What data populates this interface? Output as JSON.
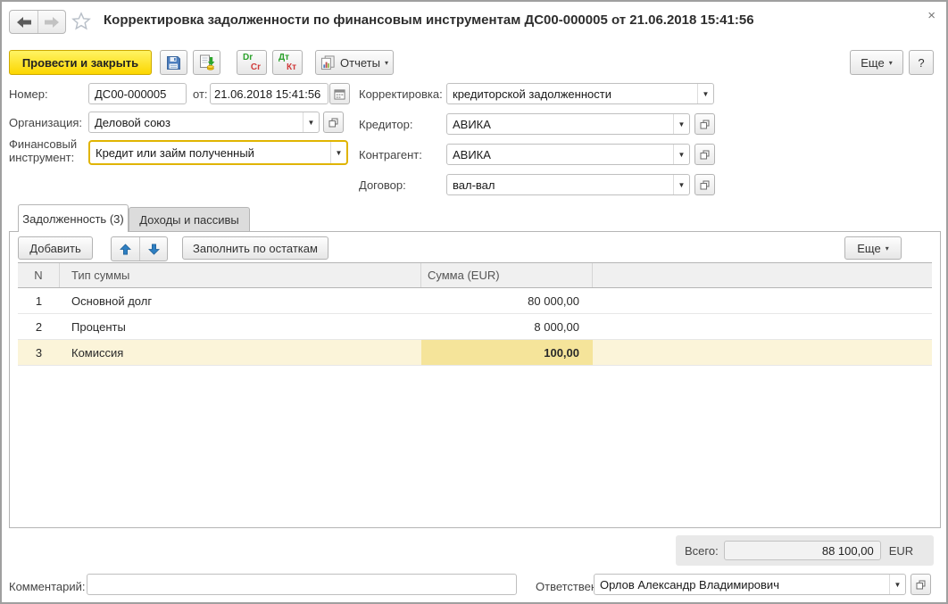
{
  "window": {
    "title": "Корректировка задолженности по финансовым инструментам ДС00-000005 от 21.06.2018 15:41:56",
    "close_glyph": "×"
  },
  "toolbar": {
    "post_and_close": "Провести и закрыть",
    "dr": "Dr",
    "cr": "Cr",
    "dt": "Дт",
    "kt": "Кт",
    "reports": "Отчеты",
    "more": "Еще",
    "help": "?",
    "caret": "▾"
  },
  "form": {
    "number_label": "Номер:",
    "number_value": "ДС00-000005",
    "date_label": "от:",
    "date_value": "21.06.2018 15:41:56",
    "correction_label": "Корректировка:",
    "correction_value": "кредиторской задолженности",
    "organization_label": "Организация:",
    "organization_value": "Деловой союз",
    "creditor_label": "Кредитор:",
    "creditor_value": "АВИКА",
    "instrument_label": "Финансовый инструмент:",
    "instrument_value": "Кредит или займ полученный",
    "counterparty_label": "Контрагент:",
    "counterparty_value": "АВИКА",
    "contract_label": "Договор:",
    "contract_value": "вал-вал"
  },
  "tabs": {
    "debt": "Задолженность (3)",
    "income": "Доходы и пассивы"
  },
  "table_toolbar": {
    "add": "Добавить",
    "fill": "Заполнить по остаткам",
    "more": "Еще",
    "caret": "▾"
  },
  "table": {
    "headers": {
      "n": "N",
      "type": "Тип суммы",
      "amount": "Сумма (EUR)"
    },
    "rows": [
      {
        "n": "1",
        "type": "Основной долг",
        "amount": "80 000,00"
      },
      {
        "n": "2",
        "type": "Проценты",
        "amount": "8 000,00"
      },
      {
        "n": "3",
        "type": "Комиссия",
        "amount": "100,00"
      }
    ]
  },
  "totals": {
    "label": "Всего:",
    "value": "88 100,00",
    "currency": "EUR"
  },
  "footer": {
    "comment_label": "Комментарий:",
    "comment_value": "",
    "responsible_label": "Ответственный:",
    "responsible_value": "Орлов Александр Владимирович"
  }
}
